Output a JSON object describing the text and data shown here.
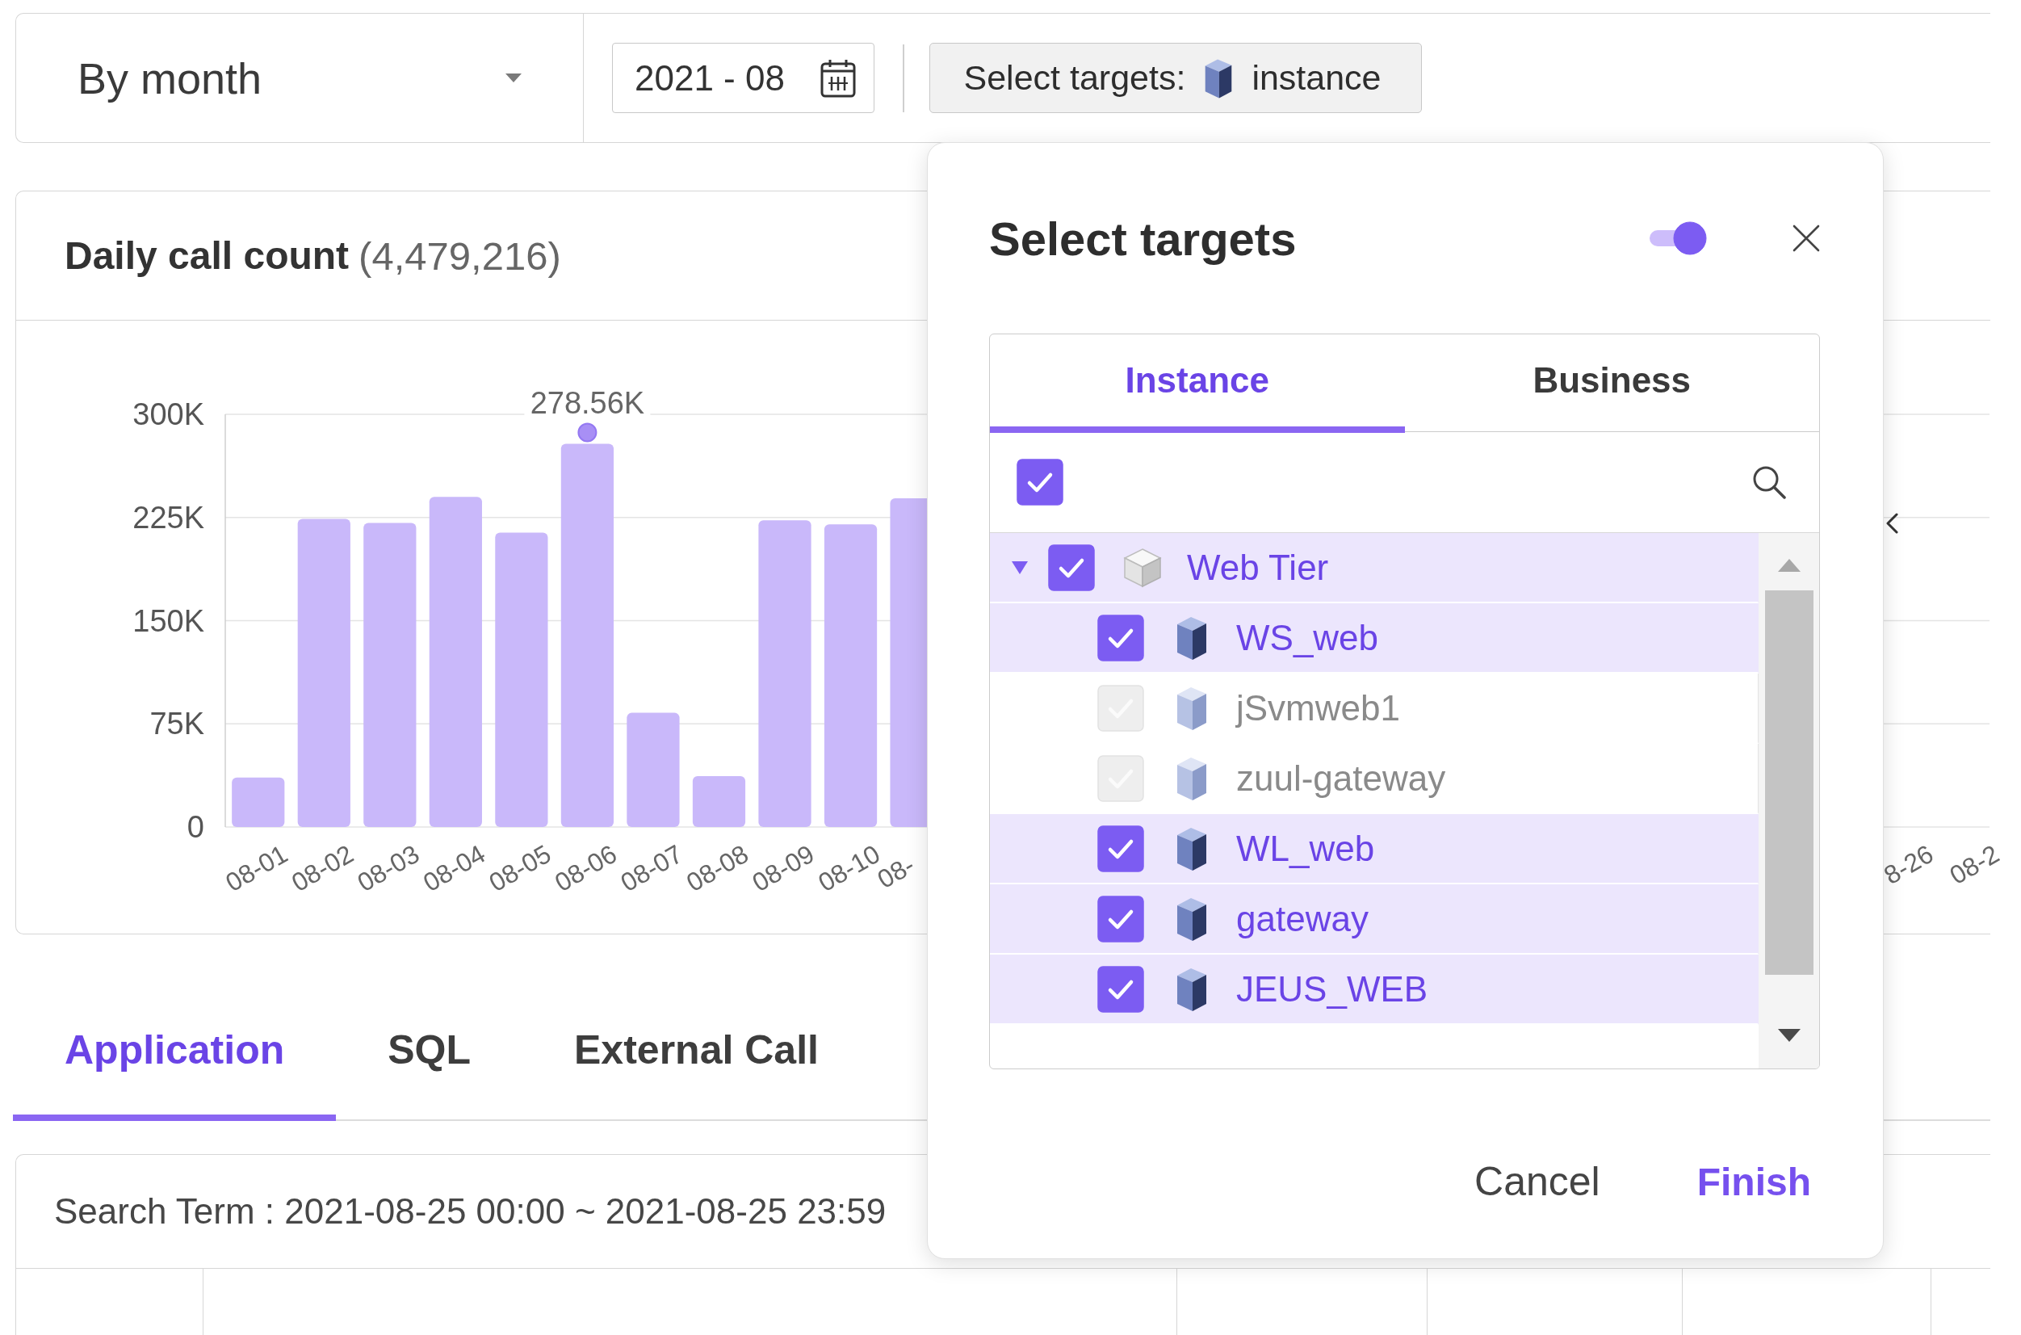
{
  "toolbar": {
    "period_dropdown": {
      "value": "By month"
    },
    "month_field": {
      "value": "2021 - 08"
    },
    "select_targets_button": {
      "label": "Select targets:",
      "value": "instance"
    }
  },
  "call_count_card": {
    "title": "Daily call count",
    "total": "(4,479,216)",
    "chart_data": {
      "type": "bar",
      "categories": [
        "08-01",
        "08-02",
        "08-03",
        "08-04",
        "08-05",
        "08-06",
        "08-07",
        "08-08",
        "08-09",
        "08-10",
        "08-",
        null,
        null,
        null,
        null,
        null,
        null,
        null,
        null,
        null,
        null,
        null,
        null,
        null,
        null,
        "8-26",
        "08-2"
      ],
      "values": [
        36000,
        224000,
        221000,
        240000,
        214000,
        278560,
        83000,
        37000,
        223000,
        220000,
        239000,
        null,
        null,
        null,
        null,
        null,
        null,
        null,
        null,
        null,
        null,
        null,
        null,
        null,
        null,
        null,
        null
      ],
      "ylim": [
        0,
        300000
      ],
      "yticks": [
        {
          "value": 0,
          "label": "0"
        },
        {
          "value": 75000,
          "label": "75K"
        },
        {
          "value": 150000,
          "label": "150K"
        },
        {
          "value": 225000,
          "label": "225K"
        },
        {
          "value": 300000,
          "label": "300K"
        }
      ],
      "grid": true,
      "annotations": [
        {
          "x": "08-06",
          "y": 278560,
          "text": "278.56K"
        }
      ]
    }
  },
  "detail_tabs": [
    {
      "label": "Application",
      "selected": true
    },
    {
      "label": "SQL",
      "selected": false
    },
    {
      "label": "External Call",
      "selected": false
    }
  ],
  "search_term": "Search Term : 2021-08-25 00:00 ~ 2021-08-25 23:59",
  "dialog": {
    "title": "Select targets",
    "toggle": {
      "on": true
    },
    "tabs": [
      {
        "label": "Instance",
        "selected": true
      },
      {
        "label": "Business",
        "selected": false
      }
    ],
    "select_all": {
      "checked": true
    },
    "tree": [
      {
        "label": "Web Tier",
        "kind": "group",
        "checked": true,
        "expanded": true,
        "children": [
          {
            "label": "WS_web",
            "kind": "instance",
            "checked": true
          },
          {
            "label": "jSvmweb1",
            "kind": "instance",
            "checked": false
          },
          {
            "label": "zuul-gateway",
            "kind": "instance",
            "checked": false
          },
          {
            "label": "WL_web",
            "kind": "instance",
            "checked": true
          },
          {
            "label": "gateway",
            "kind": "instance",
            "checked": true
          },
          {
            "label": "JEUS_WEB",
            "kind": "instance",
            "checked": true
          }
        ]
      }
    ],
    "buttons": [
      {
        "label": "Cancel",
        "kind": "secondary"
      },
      {
        "label": "Finish",
        "kind": "primary"
      }
    ]
  }
}
